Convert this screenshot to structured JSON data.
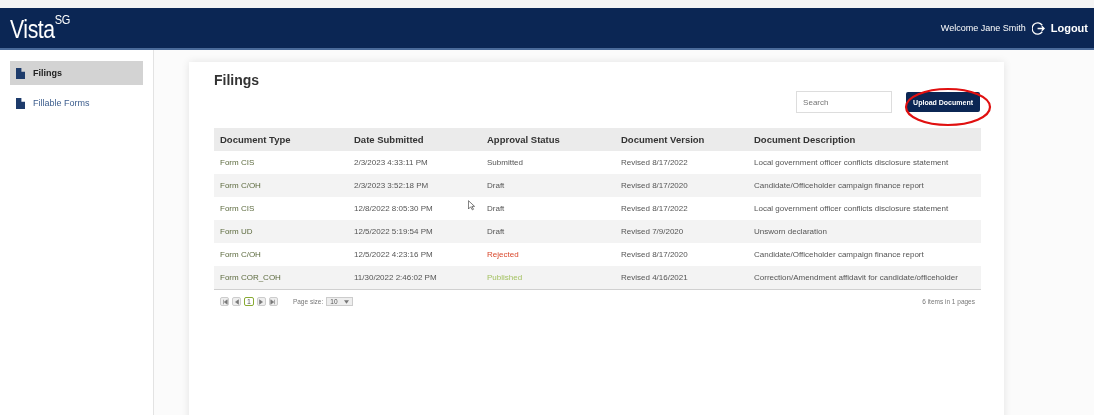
{
  "header": {
    "logo": "Vista",
    "logo_sup": "SG",
    "welcome": "Welcome Jane Smith",
    "logout": "Logout"
  },
  "sidebar": {
    "items": [
      {
        "label": "Filings",
        "selected": true
      },
      {
        "label": "Fillable Forms",
        "selected": false
      }
    ]
  },
  "page": {
    "title": "Filings",
    "search": {
      "placeholder": "Search"
    },
    "upload_button": {
      "label": "Upload Document",
      "highlighted": true
    }
  },
  "table": {
    "columns": [
      "Document Type",
      "Date Submitted",
      "Approval Status",
      "Document Version",
      "Document Description"
    ],
    "rows": [
      {
        "type": "Form CIS",
        "date": "2/3/2023 4:33:11 PM",
        "status": {
          "text": "Submitted",
          "kind": "submitted"
        },
        "version": "Revised 8/17/2022",
        "description": "Local government officer conflicts disclosure statement"
      },
      {
        "type": "Form C/OH",
        "date": "2/3/2023 3:52:18 PM",
        "status": {
          "text": "Draft",
          "kind": "draft"
        },
        "version": "Revised 8/17/2020",
        "description": "Candidate/Officeholder campaign finance report"
      },
      {
        "type": "Form CIS",
        "date": "12/8/2022 8:05:30 PM",
        "status": {
          "text": "Draft",
          "kind": "draft"
        },
        "version": "Revised 8/17/2022",
        "description": "Local government officer conflicts disclosure statement"
      },
      {
        "type": "Form UD",
        "date": "12/5/2022 5:19:54 PM",
        "status": {
          "text": "Draft",
          "kind": "draft"
        },
        "version": "Revised 7/9/2020",
        "description": "Unsworn declaration"
      },
      {
        "type": "Form C/OH",
        "date": "12/5/2022 4:23:16 PM",
        "status": {
          "text": "Rejected",
          "kind": "rejected"
        },
        "version": "Revised 8/17/2020",
        "description": "Candidate/Officeholder campaign finance report"
      },
      {
        "type": "Form COR_COH",
        "date": "11/30/2022 2:46:02 PM",
        "status": {
          "text": "Published",
          "kind": "published"
        },
        "version": "Revised 4/16/2021",
        "description": "Correction/Amendment affidavit for candidate/officeholder"
      }
    ]
  },
  "pager": {
    "current_page": "1",
    "page_size_label": "Page size:",
    "page_size": "10",
    "summary": "6 items in 1 pages"
  }
}
